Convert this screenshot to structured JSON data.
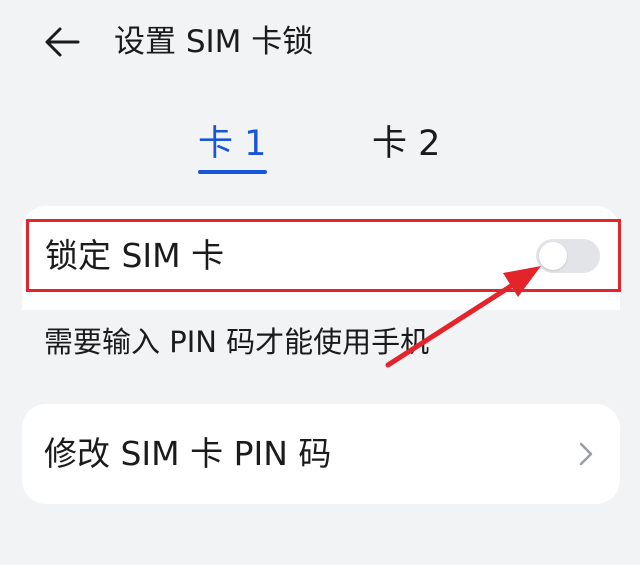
{
  "header": {
    "title": "设置 SIM 卡锁",
    "back_icon": "arrow-left-icon"
  },
  "tabs": [
    {
      "label": "卡 1",
      "selected": true
    },
    {
      "label": "卡 2",
      "selected": false
    }
  ],
  "lock_sim": {
    "label": "锁定 SIM 卡",
    "toggle_on": false
  },
  "hint": "需要输入 PIN 码才能使用手机",
  "change_pin": {
    "label": "修改 SIM 卡 PIN 码",
    "chevron_icon": "chevron-right-icon"
  },
  "colors": {
    "accent": "#1756d6",
    "highlight_box": "#e3242b",
    "annotation_arrow": "#e3242b",
    "background": "#f1f3f5",
    "card": "#ffffff",
    "toggle_off": "#e2e4e7"
  }
}
